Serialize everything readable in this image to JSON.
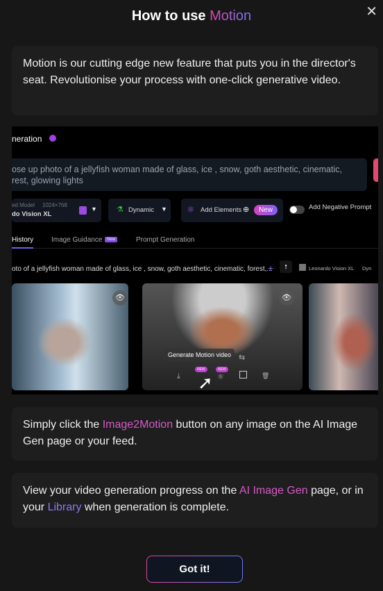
{
  "header": {
    "title_prefix": "How to use ",
    "title_accent": "Motion",
    "close_icon": "close-icon"
  },
  "intro": "Motion is our cutting edge new feature that puts you in the director's seat. Revolutionise your process with one-click generative video.",
  "screenshot": {
    "section_title": "neration",
    "prompt": "ose up photo of a jellyfish woman made of glass, ice , snow, goth aesthetic, cinematic,",
    "prompt_line2": "rest, glowing lights",
    "model_label": "ed Model",
    "model_size": "1024×768",
    "model_name": "do Vision XL",
    "style": "Dynamic",
    "add_elements": "Add Elements",
    "new": "New",
    "negative_prompt": "Add Negative Prompt",
    "tabs": [
      "History",
      "Image Guidance",
      "Prompt Generation"
    ],
    "tab_new": "New",
    "history_prompt": "oto of a jellyfish woman made of glass, ice , snow, goth aesthetic, cinematic, forest,...",
    "history_model": "Leonardo Vision XL",
    "history_style": "Dyn",
    "tooltip": "Generate Motion video",
    "badge_new": "NEW"
  },
  "step1": {
    "before": "Simply click the ",
    "link": "Image2Motion",
    "after": " button on any image on the AI Image Gen page or your feed."
  },
  "step2": {
    "before": "View your video generation progress on the ",
    "link1": "AI Image Gen",
    "middle": " page, or in your ",
    "link2": "Library",
    "after": " when generation is complete."
  },
  "confirm_label": "Got it!",
  "colors": {
    "background": "#171717",
    "card": "#1e1e1e",
    "accent_pink": "#d75ac8",
    "accent_violet": "#8b78f0"
  }
}
